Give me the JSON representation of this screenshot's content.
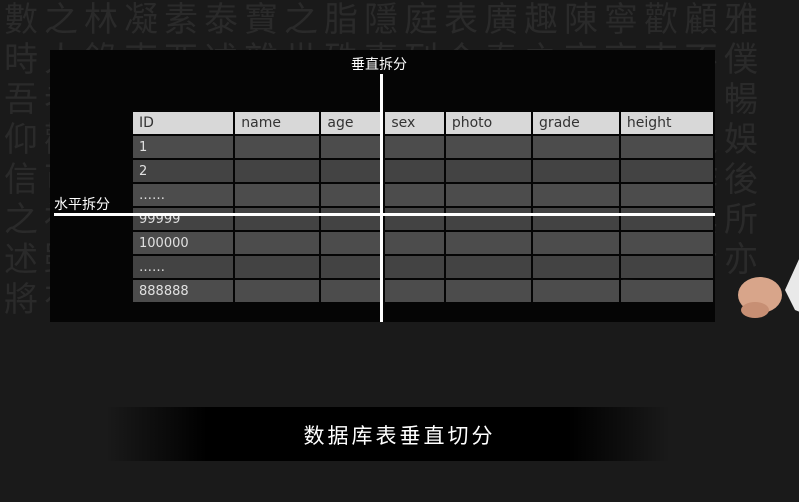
{
  "slide": {
    "vertical_split_label": "垂直拆分",
    "horizontal_split_label": "水平拆分"
  },
  "table": {
    "headers": [
      "ID",
      "name",
      "age",
      "sex",
      "photo",
      "grade",
      "height"
    ],
    "id_values": [
      "1",
      "2",
      "……",
      "99999",
      "100000",
      "……",
      "888888"
    ]
  },
  "caption": "数据库表垂直切分",
  "colors": {
    "background": "#1a1a1a",
    "slide": "#050505",
    "header_cell": "#d8d8d8",
    "data_cell": "#4c4c4c",
    "split_line": "#ffffff"
  }
}
